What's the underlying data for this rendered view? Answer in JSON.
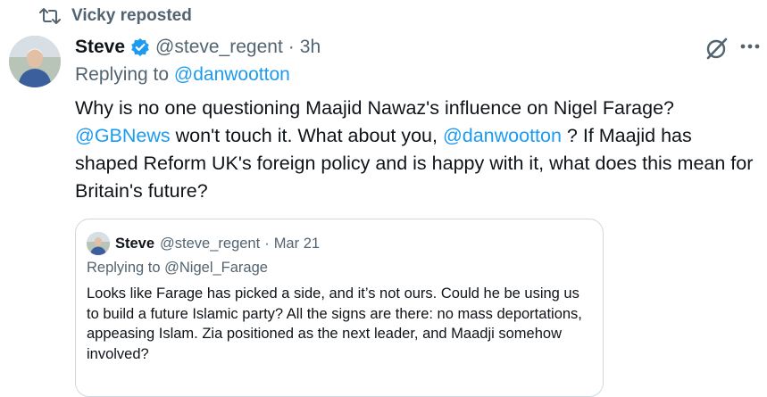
{
  "repost": {
    "icon": "repost-icon",
    "label": "Vicky reposted"
  },
  "post": {
    "author_name": "Steve",
    "verified_icon": "verified-badge-icon",
    "handle": "@steve_regent",
    "separator": "·",
    "time": "3h",
    "replying_prefix": "Replying to",
    "replying_handle": "@danwootton",
    "text_1": "Why is no one questioning Maajid Nawaz's influence on Nigel Farage?",
    "mention_1": "@GBNews",
    "text_2": " won't touch it. What about you, ",
    "mention_2": "@danwootton",
    "text_3": " ? If Maajid has shaped Reform UK's foreign policy and is happy with it, what does this mean for Britain's future?",
    "colors": {
      "link": "#1d9bf0",
      "muted": "#536471",
      "verified": "#1d9bf0"
    }
  },
  "actions": {
    "grok_icon": "grok-icon",
    "more_icon": "more-options-icon"
  },
  "quote": {
    "author_name": "Steve",
    "handle": "@steve_regent",
    "separator": "·",
    "time": "Mar 21",
    "replying": "Replying to @Nigel_Farage",
    "text": "Looks like Farage has picked a side, and it’s not ours. Could he be using us to build a future Islamic party? All the signs are there: no mass deportations, appeasing Islam. Zia positioned as the next leader, and Maadji somehow involved?"
  }
}
